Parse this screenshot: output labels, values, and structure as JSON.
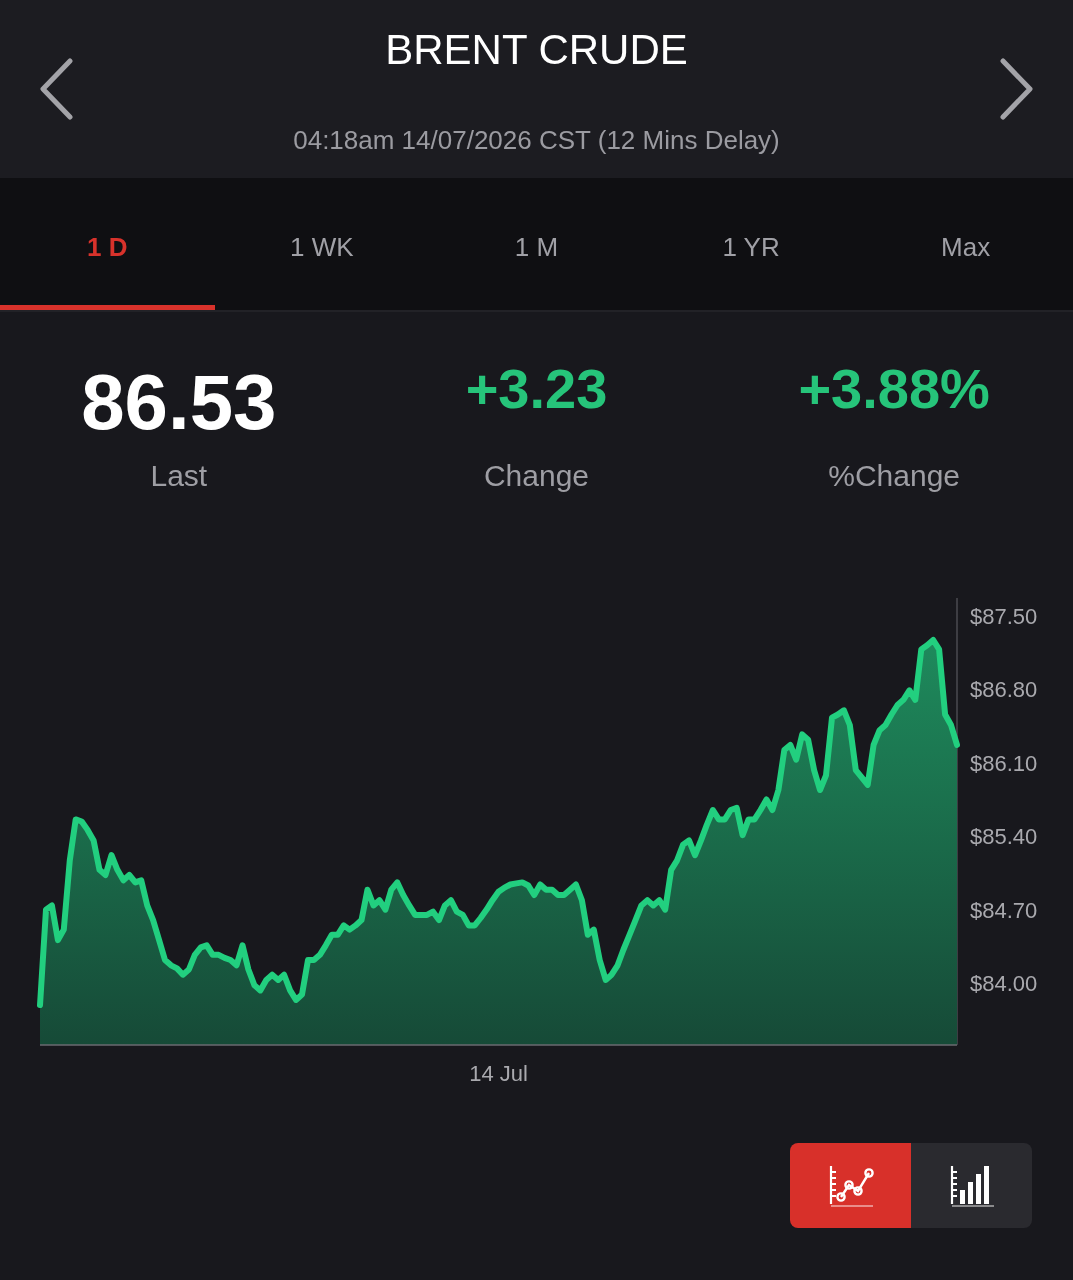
{
  "header": {
    "title": "BRENT CRUDE",
    "subtitle": "04:18am 14/07/2026 CST (12 Mins Delay)"
  },
  "tabs": [
    {
      "label": "1 D",
      "selected": true
    },
    {
      "label": "1 WK",
      "selected": false
    },
    {
      "label": "1 M",
      "selected": false
    },
    {
      "label": "1 YR",
      "selected": false
    },
    {
      "label": "Max",
      "selected": false
    }
  ],
  "stats": [
    {
      "kind": "price",
      "value": "86.53",
      "label": "Last"
    },
    {
      "kind": "change",
      "value": "+3.23",
      "label": "Change"
    },
    {
      "kind": "change",
      "value": "+3.88%",
      "label": "%Change"
    }
  ],
  "chart": {
    "chart_data": {
      "type": "area",
      "xlabel": "14 Jul",
      "values": [
        83.79,
        84.7,
        84.74,
        84.41,
        84.51,
        85.17,
        85.56,
        85.54,
        85.46,
        85.36,
        85.08,
        85.03,
        85.22,
        85.08,
        84.98,
        85.03,
        84.96,
        84.98,
        84.74,
        84.6,
        84.41,
        84.22,
        84.17,
        84.14,
        84.08,
        84.13,
        84.27,
        84.34,
        84.36,
        84.27,
        84.27,
        84.24,
        84.22,
        84.17,
        84.36,
        84.13,
        83.98,
        83.93,
        84.03,
        84.08,
        84.03,
        84.08,
        83.93,
        83.84,
        83.89,
        84.22,
        84.22,
        84.27,
        84.36,
        84.46,
        84.46,
        84.55,
        84.51,
        84.55,
        84.6,
        84.89,
        84.74,
        84.79,
        84.7,
        84.89,
        84.96,
        84.84,
        84.74,
        84.65,
        84.65,
        84.65,
        84.68,
        84.6,
        84.74,
        84.79,
        84.68,
        84.65,
        84.55,
        84.55,
        84.62,
        84.7,
        84.79,
        84.87,
        84.91,
        84.94,
        84.95,
        84.96,
        84.93,
        84.84,
        84.94,
        84.89,
        84.89,
        84.84,
        84.84,
        84.89,
        84.94,
        84.79,
        84.46,
        84.51,
        84.22,
        84.03,
        84.08,
        84.17,
        84.32,
        84.46,
        84.6,
        84.74,
        84.79,
        84.74,
        84.79,
        84.7,
        85.08,
        85.17,
        85.32,
        85.36,
        85.22,
        85.36,
        85.51,
        85.65,
        85.56,
        85.56,
        85.65,
        85.67,
        85.41,
        85.56,
        85.56,
        85.65,
        85.75,
        85.65,
        85.84,
        86.22,
        86.27,
        86.13,
        86.37,
        86.32,
        86.03,
        85.84,
        85.98,
        86.53,
        86.56,
        86.6,
        86.46,
        86.03,
        85.96,
        85.89,
        86.27,
        86.41,
        86.46,
        86.56,
        86.65,
        86.7,
        86.79,
        86.7,
        87.18,
        87.22,
        87.27,
        87.18,
        86.56,
        86.46,
        86.27
      ],
      "ylim": [
        83.41,
        87.67
      ],
      "yticks": [
        {
          "value": 87.5,
          "label": "$87.50"
        },
        {
          "value": 86.8,
          "label": "$86.80"
        },
        {
          "value": 86.1,
          "label": "$86.10"
        },
        {
          "value": 85.4,
          "label": "$85.40"
        },
        {
          "value": 84.7,
          "label": "$84.70"
        },
        {
          "value": 84.0,
          "label": "$84.00"
        }
      ]
    }
  },
  "chart_types": [
    {
      "kind": "line",
      "selected": true
    },
    {
      "kind": "bar",
      "selected": false
    }
  ]
}
